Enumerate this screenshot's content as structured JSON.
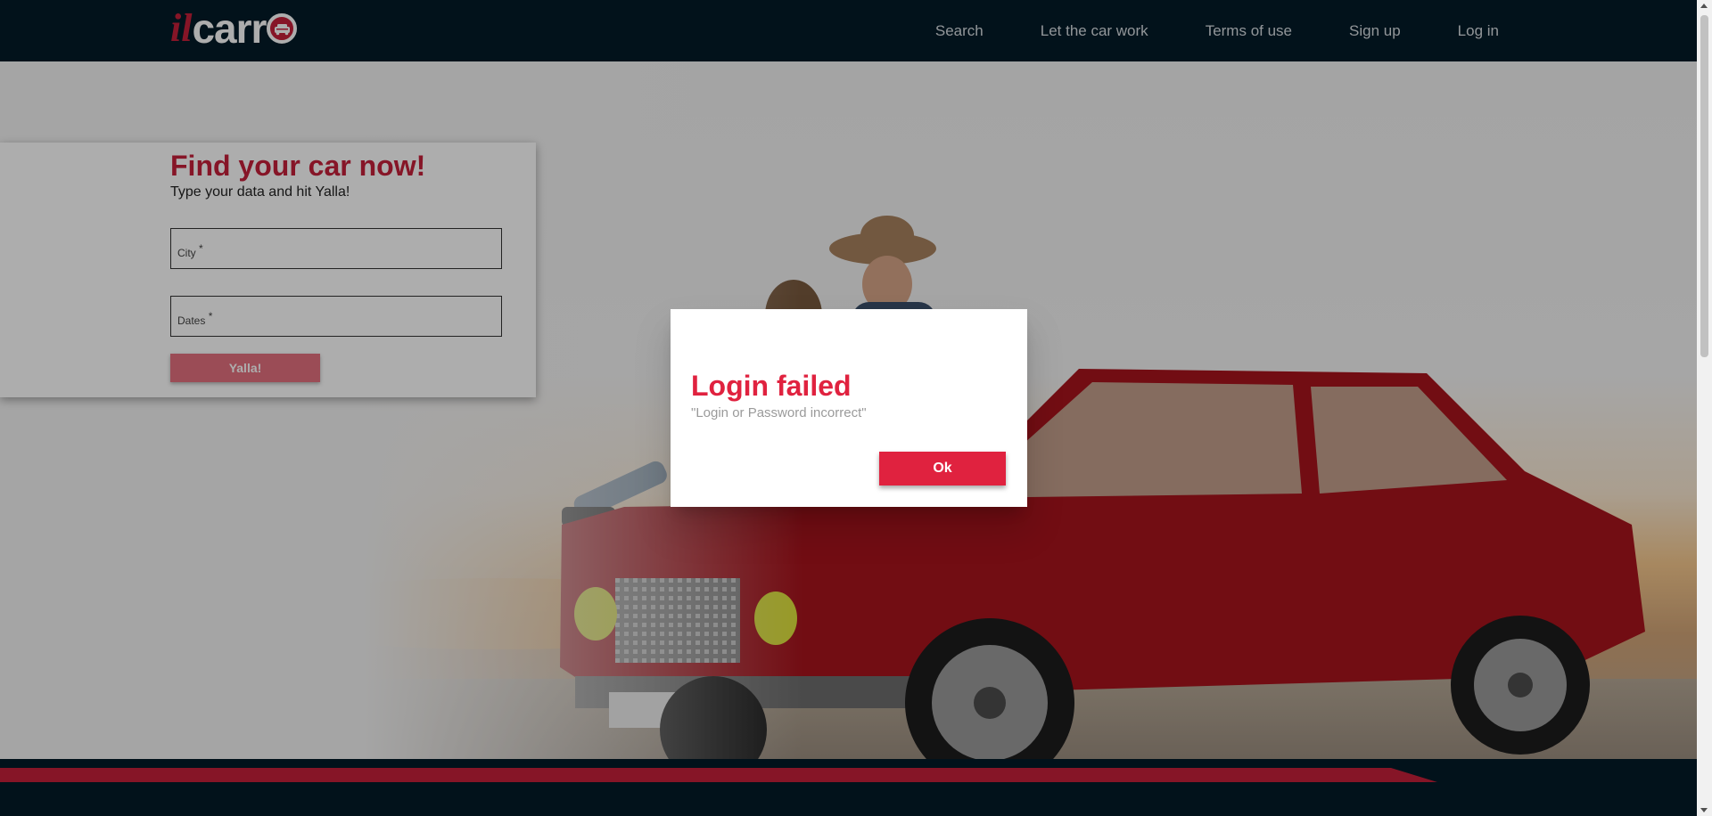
{
  "header": {
    "logo": {
      "part_il": "il",
      "part_carr": "carr",
      "icon": "car-icon"
    },
    "nav": [
      {
        "label": "Search"
      },
      {
        "label": "Let the car work"
      },
      {
        "label": "Terms of use"
      },
      {
        "label": "Sign up"
      },
      {
        "label": "Log in"
      }
    ]
  },
  "search": {
    "title": "Find your car now!",
    "subtitle": "Type your data and hit Yalla!",
    "city_label": "City",
    "dates_label": "Dates",
    "required_mark": "*",
    "submit_label": "Yalla!"
  },
  "dialog": {
    "title": "Login failed",
    "message": "\"Login or Password incorrect\"",
    "ok_label": "Ok"
  },
  "colors": {
    "brand_red": "#e0223f",
    "header_bg": "#031b28"
  }
}
